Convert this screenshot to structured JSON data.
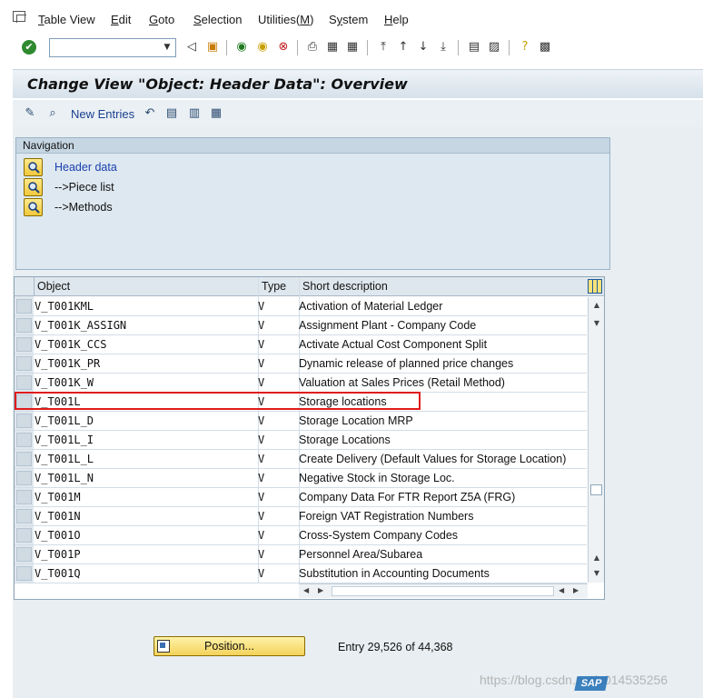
{
  "menubar": {
    "items": [
      {
        "label": "Table View",
        "underline": "T"
      },
      {
        "label": "Edit",
        "underline": "E"
      },
      {
        "label": "Goto",
        "underline": "G"
      },
      {
        "label": "Selection",
        "underline": "S"
      },
      {
        "label": "Utilities(M)",
        "underline": "M"
      },
      {
        "label": "System",
        "underline": "y"
      },
      {
        "label": "Help",
        "underline": "H"
      }
    ]
  },
  "toolbar": {
    "command_field": {
      "value": "",
      "placeholder": ""
    }
  },
  "title": "Change View \"Object: Header Data\": Overview",
  "app_toolbar": {
    "new_entries": "New Entries"
  },
  "navigation": {
    "header": "Navigation",
    "items": [
      {
        "label": "Header data",
        "active": true
      },
      {
        "label": "-->Piece list",
        "active": false
      },
      {
        "label": "-->Methods",
        "active": false
      }
    ]
  },
  "table": {
    "headers": {
      "object": "Object",
      "type": "Type",
      "description": "Short description"
    },
    "rows": [
      {
        "object": "V_T001KML",
        "type": "V",
        "description": "Activation of Material Ledger"
      },
      {
        "object": "V_T001K_ASSIGN",
        "type": "V",
        "description": "Assignment Plant - Company Code"
      },
      {
        "object": "V_T001K_CCS",
        "type": "V",
        "description": "Activate Actual Cost Component Split"
      },
      {
        "object": "V_T001K_PR",
        "type": "V",
        "description": "Dynamic release of planned price changes"
      },
      {
        "object": "V_T001K_W",
        "type": "V",
        "description": "Valuation at Sales Prices (Retail Method)"
      },
      {
        "object": "V_T001L",
        "type": "V",
        "description": "Storage locations"
      },
      {
        "object": "V_T001L_D",
        "type": "V",
        "description": "Storage Location MRP"
      },
      {
        "object": "V_T001L_I",
        "type": "V",
        "description": "Storage Locations"
      },
      {
        "object": "V_T001L_L",
        "type": "V",
        "description": "Create Delivery (Default Values for Storage Location)"
      },
      {
        "object": "V_T001L_N",
        "type": "V",
        "description": "Negative Stock in Storage Loc."
      },
      {
        "object": "V_T001M",
        "type": "V",
        "description": "Company Data For FTR Report Z5A (FRG)"
      },
      {
        "object": "V_T001N",
        "type": "V",
        "description": "Foreign VAT Registration Numbers"
      },
      {
        "object": "V_T001O",
        "type": "V",
        "description": "Cross-System Company Codes"
      },
      {
        "object": "V_T001P",
        "type": "V",
        "description": "Personnel Area/Subarea"
      },
      {
        "object": "V_T001Q",
        "type": "V",
        "description": "Substitution in Accounting Documents"
      }
    ],
    "highlighted_row": 5
  },
  "footer": {
    "position_button": "Position...",
    "entry_text": "Entry 29,526 of 44,368"
  },
  "watermark": "https://blog.csdn.net/u014535256",
  "logo_text": "SAP",
  "colors": {
    "title_band": "#dbe5ed",
    "highlight_border": "#e01b1b",
    "link": "#1a3fae",
    "button_yellow": "#f3d25a"
  }
}
